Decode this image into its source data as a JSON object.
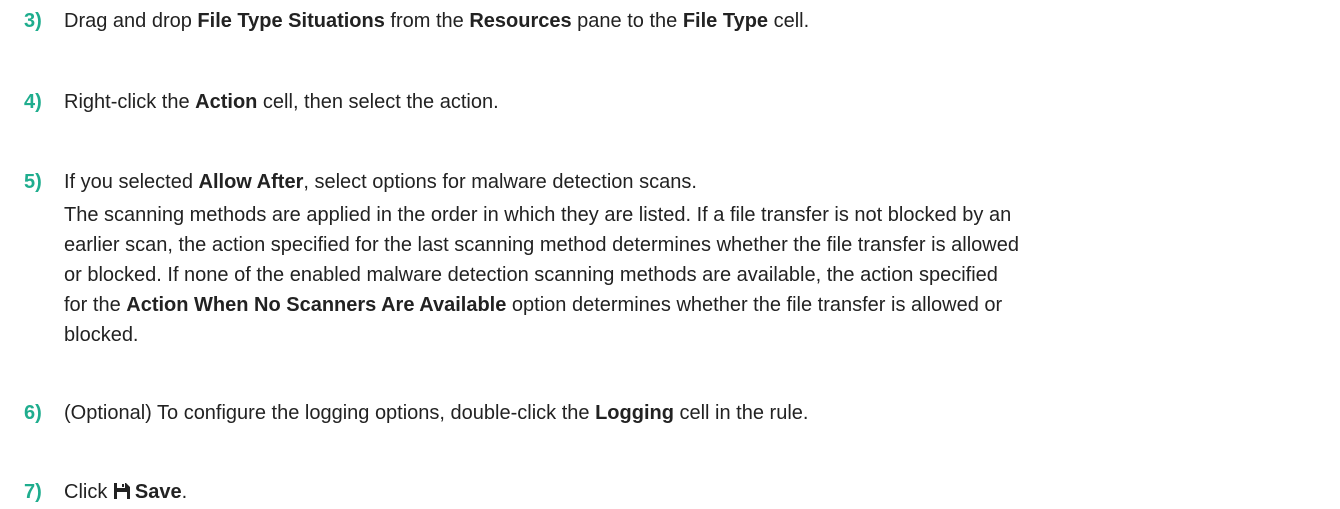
{
  "accent_color": "#1fad8e",
  "steps": [
    {
      "number": "3)",
      "parts": [
        "Drag and drop ",
        "File Type Situations",
        " from the ",
        "Resources",
        " pane to the ",
        "File Type",
        " cell."
      ]
    },
    {
      "number": "4)",
      "parts": [
        "Right-click the ",
        "Action",
        " cell, then select the action."
      ]
    },
    {
      "number": "5)",
      "parts": [
        "If you selected ",
        "Allow After",
        ", select options for malware detection scans."
      ],
      "paragraph": {
        "line1": "The scanning methods are applied in the order in which they are listed. If a file transfer is not blocked by an",
        "line2": "earlier scan, the action specified for the last scanning method determines whether the file transfer is allowed",
        "line3": "or blocked. If none of the enabled malware detection scanning methods are available, the action specified",
        "line4_a": "for the ",
        "line4_b": "Action When No Scanners Are Available",
        "line4_c": " option determines whether the file transfer is allowed or",
        "line5": "blocked."
      }
    },
    {
      "number": "6)",
      "parts": [
        "(Optional) To configure the logging options, double-click the ",
        "Logging",
        " cell in the rule."
      ]
    },
    {
      "number": "7)",
      "parts": [
        "Click ",
        "Save",
        "."
      ],
      "icon": "save-icon"
    }
  ]
}
